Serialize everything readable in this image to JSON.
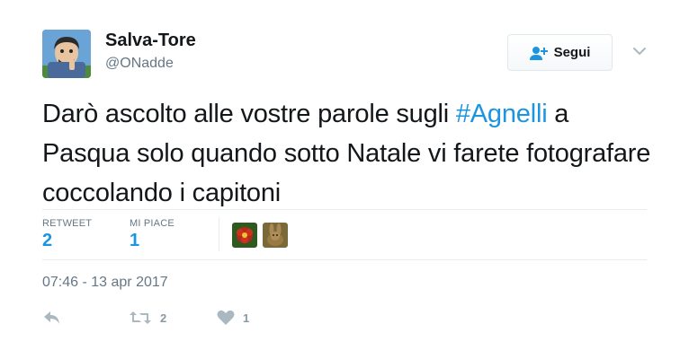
{
  "author": {
    "name": "Salva-Tore",
    "handle": "@ONadde",
    "avatar_icon": "cartoon-avatar"
  },
  "follow_button": {
    "label": "Segui",
    "icon": "add-user-icon"
  },
  "tweet": {
    "text_before": "Darò ascolto alle vostre parole sugli ",
    "hashtag": "#Agnelli",
    "text_after": " a Pasqua solo quando sotto Natale vi farete fotografare coccolando i capitoni"
  },
  "stats": {
    "retweets_label": "RETWEET",
    "retweets_count": "2",
    "likes_label": "MI PIACE",
    "likes_count": "1"
  },
  "likers": [
    {
      "name": "liker-avatar-flower",
      "color": "#b5271a"
    },
    {
      "name": "liker-avatar-rabbit",
      "color": "#9a7a44"
    }
  ],
  "timestamp": "07:46 - 13 apr 2017",
  "actions": {
    "reply_icon": "reply-icon",
    "retweet_icon": "retweet-icon",
    "retweet_count": "2",
    "like_icon": "heart-icon",
    "like_count": "1"
  },
  "colors": {
    "link": "#1b95e0",
    "text": "#14171a",
    "secondary": "#657786",
    "icon": "#aab8c2"
  }
}
